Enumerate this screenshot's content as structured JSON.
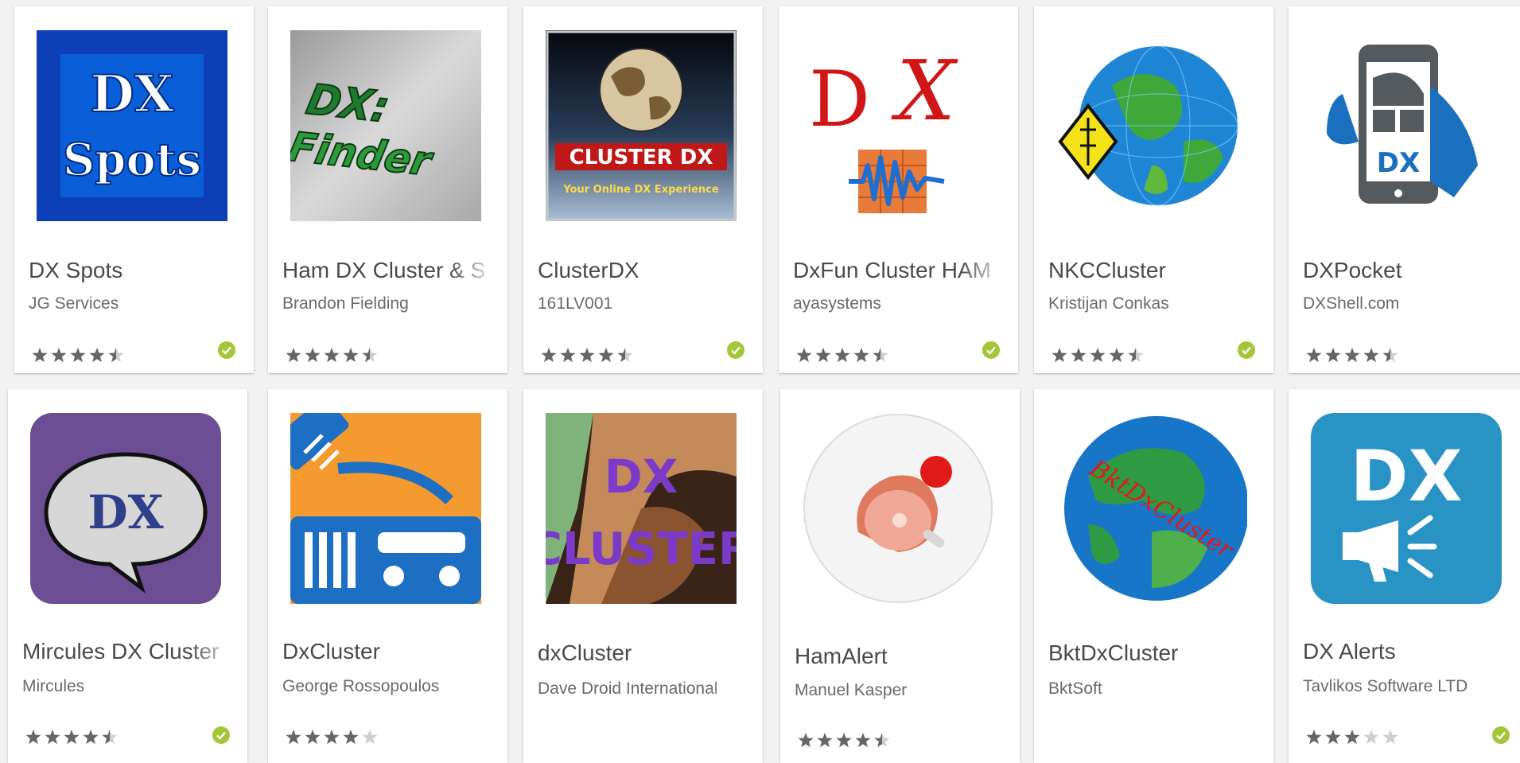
{
  "apps": [
    {
      "title": "DX Spots",
      "developer": "JG Services",
      "rating": 4.5,
      "verified": true,
      "icon": "dx-spots-icon"
    },
    {
      "title": "Ham DX Cluster & S",
      "developer": "Brandon Fielding",
      "rating": 4.5,
      "verified": false,
      "icon": "dx-finder-icon"
    },
    {
      "title": "ClusterDX",
      "developer": "161LV001",
      "rating": 4.5,
      "verified": true,
      "icon": "cluster-dx-globe-icon",
      "icon_text": [
        "CLUSTER DX",
        "Your Online DX Experience"
      ]
    },
    {
      "title": "DxFun Cluster HAM",
      "developer": "ayasystems",
      "rating": 4.5,
      "verified": true,
      "icon": "dxfun-waveform-icon"
    },
    {
      "title": "NKCCluster",
      "developer": "Kristijan Conkas",
      "rating": 4.5,
      "verified": true,
      "icon": "globe-antenna-icon"
    },
    {
      "title": "DXPocket",
      "developer": "DXShell.com",
      "rating": 4.5,
      "verified": false,
      "icon": "phone-in-hand-icon"
    },
    {
      "title": "Mircules DX Cluster",
      "developer": "Mircules",
      "rating": 4.5,
      "verified": true,
      "icon": "speech-bubble-icon"
    },
    {
      "title": "DxCluster",
      "developer": "George Rossopoulos",
      "rating": 4.0,
      "verified": false,
      "icon": "radio-transceiver-icon"
    },
    {
      "title": "dxCluster",
      "developer": "Dave Droid International",
      "rating": null,
      "verified": false,
      "icon": "portrait-poster-icon",
      "icon_text": [
        "DX",
        "CLUSTER"
      ]
    },
    {
      "title": "HamAlert",
      "developer": "Manuel Kasper",
      "rating": 4.5,
      "verified": false,
      "icon": "ham-alert-icon"
    },
    {
      "title": "BktDxCluster",
      "developer": "BktSoft",
      "rating": null,
      "verified": false,
      "icon": "globe-text-icon",
      "icon_text": [
        "BktDxCluster"
      ]
    },
    {
      "title": "DX Alerts",
      "developer": "Tavlikos Software LTD",
      "rating": 3.0,
      "verified": true,
      "icon": "megaphone-icon"
    }
  ],
  "colors": {
    "star": "#666666",
    "star_empty": "#cfcfcf",
    "verified": "#a4c639"
  }
}
